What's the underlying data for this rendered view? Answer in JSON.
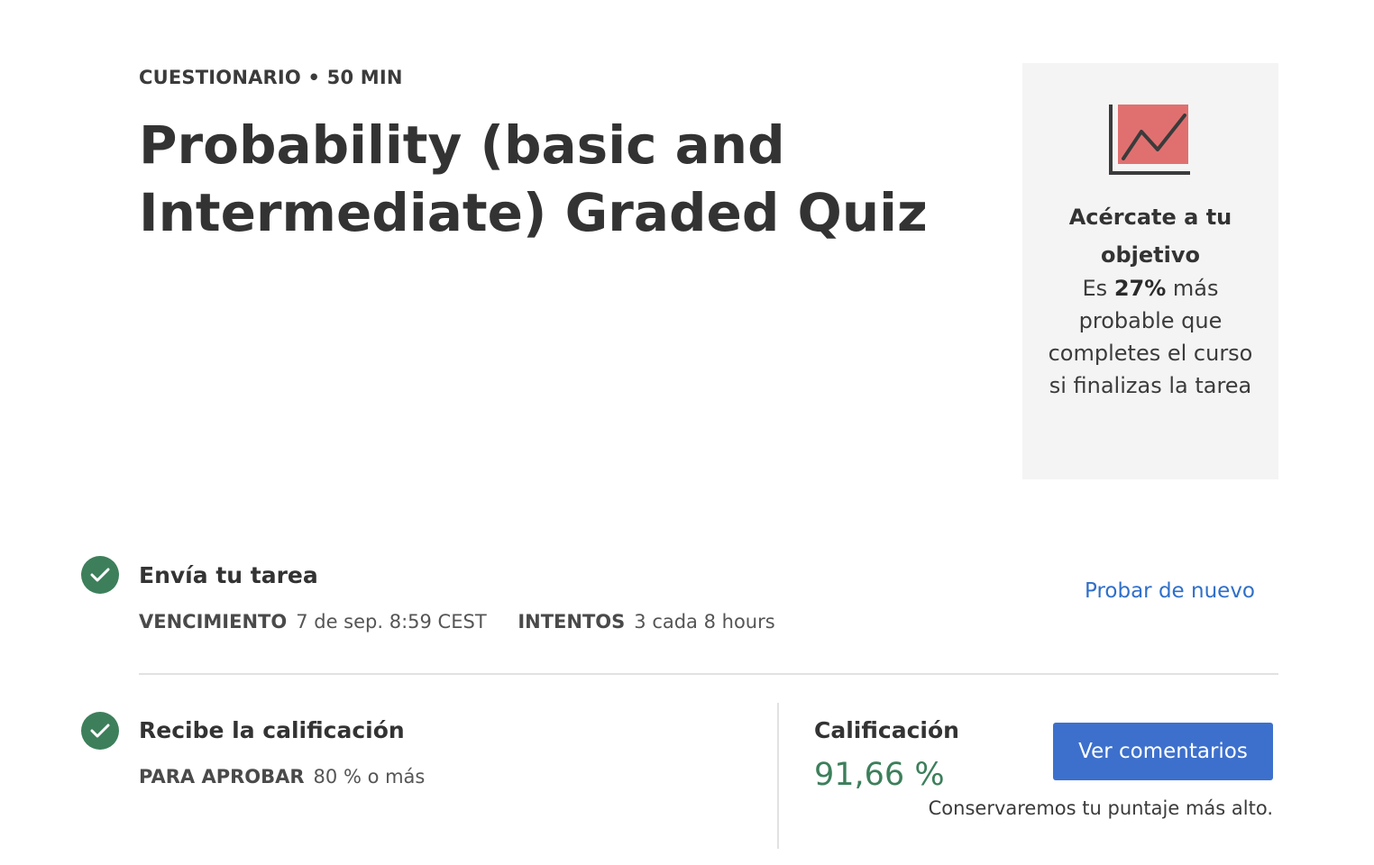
{
  "header": {
    "eyebrow": "CUESTIONARIO • 50 MIN",
    "title": "Probability (basic and Intermediate) Graded Quiz"
  },
  "goal_card": {
    "icon": "chart-trend-icon",
    "heading": "Acércate a tu objetivo",
    "body_prefix": "Es ",
    "body_highlight": "27%",
    "body_suffix": " más probable que completes el curso si finalizas la tarea",
    "icon_fill_color": "#e07070"
  },
  "steps": {
    "submit": {
      "title": "Envía tu tarea",
      "due_label": "VENCIMIENTO",
      "due_value": "7 de sep. 8:59 CEST",
      "attempts_label": "INTENTOS",
      "attempts_value": "3 cada 8 hours",
      "retry_link": "Probar de nuevo"
    },
    "grade": {
      "title": "Recibe la calificación",
      "pass_label": "PARA APROBAR",
      "pass_value": "80 % o más"
    }
  },
  "result": {
    "grade_label": "Calificación",
    "grade_value": "91,66 %",
    "feedback_button": "Ver comentarios",
    "keep_note": "Conservaremos tu puntaje más alto."
  },
  "colors": {
    "success": "#3d7f5b",
    "link": "#2f6fc9",
    "button": "#3d70cc",
    "card_bg": "#f4f4f4"
  }
}
